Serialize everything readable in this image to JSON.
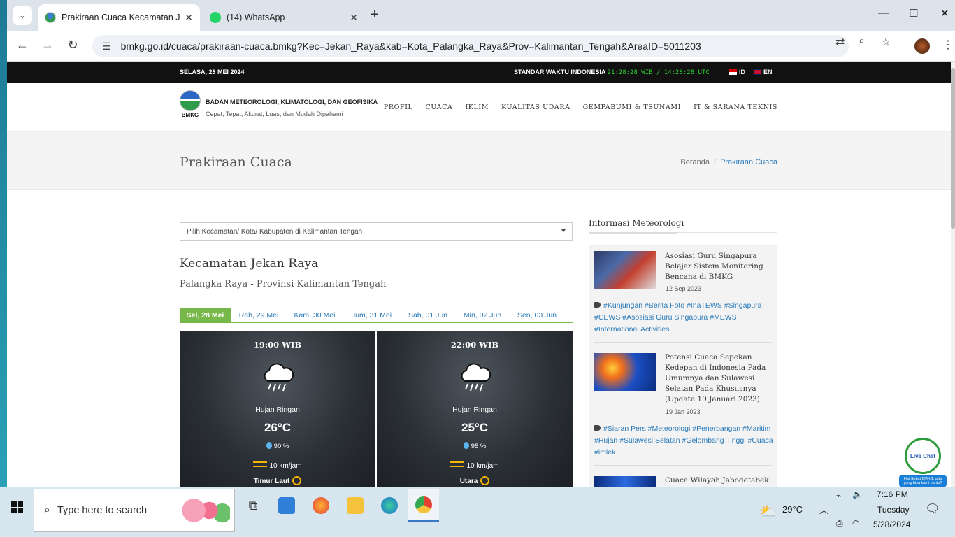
{
  "browser": {
    "tabs": [
      {
        "title": "Prakiraan Cuaca Kecamatan Jekan Raya",
        "active": true
      },
      {
        "title": "(14) WhatsApp",
        "active": false
      }
    ],
    "url": "bmkg.go.id/cuaca/prakiraan-cuaca.bmkg?Kec=Jekan_Raya&kab=Kota_Palangka_Raya&Prov=Kalimantan_Tengah&AreaID=5011203",
    "icons": {
      "tab_search": "chevron-down-icon",
      "close_tab": "close-icon",
      "new_tab": "plus-icon",
      "minimize": "minimize-icon",
      "maximize": "maximize-icon",
      "close_window": "close-icon",
      "back": "back-arrow-icon",
      "forward": "forward-arrow-icon",
      "reload": "reload-icon",
      "site_info": "tune-icon",
      "translate": "translate-icon",
      "zoom": "zoom-icon",
      "bookmark": "star-icon",
      "menu": "kebab-icon"
    }
  },
  "topbar": {
    "date": "SELASA, 28 MEI 2024",
    "std_label": "STANDAR WAKTU INDONESIA",
    "clock": "21:28:28 WIB / 14:28:28 UTC",
    "lang_id": "ID",
    "lang_en": "EN"
  },
  "header": {
    "logo_text": "BMKG",
    "org_name": "BADAN METEOROLOGI, KLIMATOLOGI, DAN GEOFISIKA",
    "tagline": "Cepat, Tepat, Akurat, Luas, dan Mudah Dipahami",
    "menu": [
      "PROFIL",
      "CUACA",
      "IKLIM",
      "KUALITAS UDARA",
      "GEMPABUMI & TSUNAMI",
      "IT & SARANA TEKNIS"
    ]
  },
  "titlebar": {
    "title": "Prakiraan Cuaca",
    "breadcrumb_home": "Beranda",
    "breadcrumb_sep": "/",
    "breadcrumb_current": "Prakiraan Cuaca"
  },
  "selector": {
    "placeholder": "Pilih Kecamatan/ Kota/ Kabupaten di Kalimantan Tengah"
  },
  "location": {
    "title": "Kecamatan Jekan Raya",
    "subtitle": "Palangka Raya - Provinsi Kalimantan Tengah"
  },
  "days": [
    "Sel, 28 Mei",
    "Rab, 29 Mei",
    "Kam, 30 Mei",
    "Jum, 31 Mei",
    "Sab, 01 Jun",
    "Min, 02 Jun",
    "Sen, 03 Jun"
  ],
  "forecast": [
    {
      "time": "19:00 WIB",
      "icon": "rain-cloud-icon",
      "condition": "Hujan Ringan",
      "temp": "26°C",
      "humidity": "90 %",
      "wind": "10 km/jam",
      "direction": "Timur Laut"
    },
    {
      "time": "22:00 WIB",
      "icon": "rain-cloud-icon",
      "condition": "Hujan Ringan",
      "temp": "25°C",
      "humidity": "95 %",
      "wind": "10 km/jam",
      "direction": "Utara"
    }
  ],
  "sidebar": {
    "title": "Informasi Meteorologi",
    "news": [
      {
        "title": "Asosiasi Guru Singapura Belajar Sistem Monitoring Bencana di BMKG",
        "date": "12 Sep 2023",
        "tags": "#Kunjungan #Berita Foto #InaTEWS #Singapura #CEWS #Asosiasi Guru Singapura #MEWS #International Activities"
      },
      {
        "title": "Potensi Cuaca Sepekan Kedepan di Indonesia Pada Umumnya dan Sulawesi Selatan Pada Khususnya (Update 19 Januari 2023)",
        "date": "19 Jan 2023",
        "tags": "#Siaran Pers #Meteorologi #Penerbangan #Maritim #Hujan #Sulawesi Selatan #Gelombang Tinggi #Cuaca #imlek"
      },
      {
        "title": "Cuaca Wilayah Jabodetabek"
      }
    ]
  },
  "livechat": {
    "label": "Live Chat",
    "note": "Hai Sobat BMKG, ada yang bisa kami bantu?"
  },
  "taskbar": {
    "search_placeholder": "Type here to search",
    "weather": "29°C",
    "time": "7:16 PM",
    "day": "Tuesday",
    "date": "5/28/2024"
  }
}
